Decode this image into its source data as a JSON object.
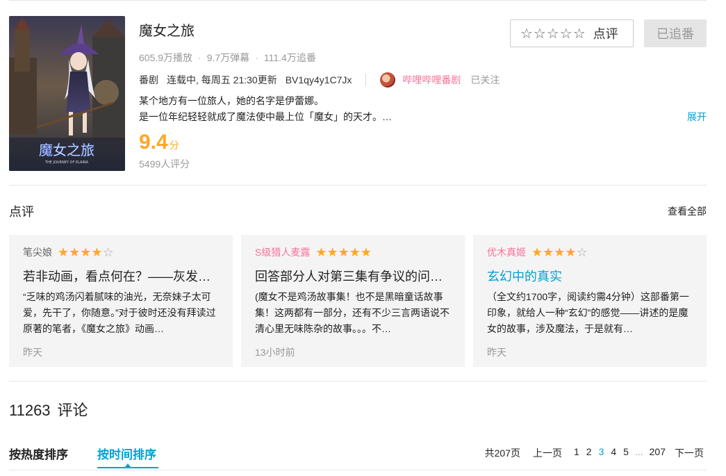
{
  "anime": {
    "title": "魔女之旅",
    "plays": "605.9万播放",
    "danmaku": "9.7万弹幕",
    "follows": "111.4万追番",
    "category": "番剧",
    "status": "连载中, 每周五 21:30更新",
    "bvid": "BV1qy4y1C7Jx",
    "publisher": "哔哩哔哩番剧",
    "publisher_status": "已关注",
    "desc_line1": "某个地方有一位旅人，她的名字是伊蕾娜。",
    "desc_line2": "是一位年纪轻轻就成了魔法使中最上位「魔女」的天才。…",
    "expand": "展开",
    "score": "9.4",
    "score_unit": "分",
    "raters": "5499人评分",
    "cover_text": "魔女之旅",
    "cover_subtext": "THE JOURNEY OF ELAINA",
    "rating_stars": "☆☆☆☆☆",
    "review_button": "点评",
    "follow_button": "已追番"
  },
  "reviews_section": {
    "title": "点评",
    "view_all": "查看全部",
    "cards": [
      {
        "user": "笔尖娘",
        "stars": 4,
        "title": "若非动画，看点何在？——灰发魔女的旅行与赞歌",
        "body": "“乏味的鸡汤闪着腻味的油光，无奈妹子太可爱，先干了，你随意。”对于彼时还没有拜读过原著的笔者，《魔女之旅》动画…",
        "time": "昨天"
      },
      {
        "user": "S级猎人麦露",
        "stars": 5,
        "title": "回答部分人对第三集有争议的问题与看法",
        "body": "(魔女不是鸡汤故事集！也不是黑暗童话故事集！这两都有一部分，还有不少三言两语说不清心里无味陈杂的故事。。。不…",
        "time": "13小时前"
      },
      {
        "user": "优木真姬",
        "stars": 4,
        "title": "玄幻中的真实",
        "body": "（全文约1700字，阅读约需4分钟）这部番第一印象，就给人一种“玄幻”的感觉——讲述的是魔女的故事，涉及魔法，于是就有…",
        "time": "昨天"
      }
    ]
  },
  "comments": {
    "count": "11263",
    "label": "评论",
    "sort_hot": "按热度排序",
    "sort_time": "按时间排序",
    "pager": {
      "total": "共207页",
      "prev": "上一页",
      "pages": [
        "1",
        "2",
        "3",
        "4",
        "5"
      ],
      "current": "3",
      "ellipsis": "...",
      "last": "207",
      "next": "下一页"
    }
  }
}
